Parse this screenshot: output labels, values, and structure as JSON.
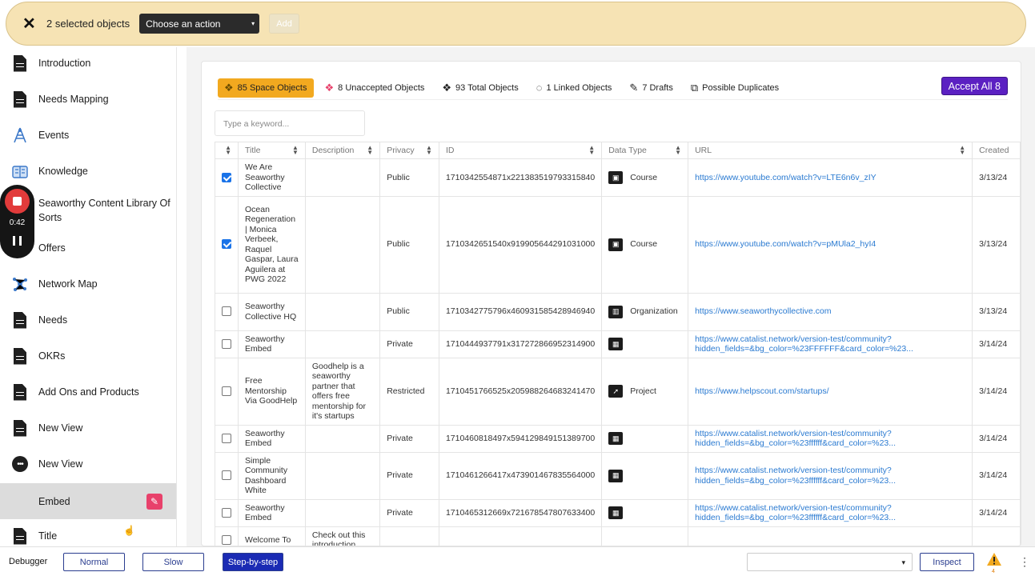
{
  "topbar": {
    "selected_text": "2 selected objects",
    "action_placeholder": "Choose an action",
    "add_label": "Add"
  },
  "sidebar": {
    "items": [
      {
        "label": "Introduction",
        "icon": "document-icon"
      },
      {
        "label": "Needs Mapping",
        "icon": "document-icon"
      },
      {
        "label": "Events",
        "icon": "events-icon"
      },
      {
        "label": "Knowledge",
        "icon": "knowledge-icon"
      },
      {
        "label": "Seaworthy Content Library Of Sorts",
        "icon": "library-icon"
      },
      {
        "label": "Offers",
        "icon": "offers-icon"
      },
      {
        "label": "Network Map",
        "icon": "network-icon"
      },
      {
        "label": "Needs",
        "icon": "document-icon"
      },
      {
        "label": "OKRs",
        "icon": "document-icon"
      },
      {
        "label": "Add Ons and Products",
        "icon": "document-icon"
      },
      {
        "label": "New View",
        "icon": "document-icon"
      },
      {
        "label": "New View",
        "icon": "chat-icon"
      },
      {
        "label": "Embed",
        "icon": "none"
      },
      {
        "label": "Title",
        "icon": "document-icon"
      }
    ]
  },
  "recorder": {
    "time": "0:42"
  },
  "tabs": [
    {
      "label": "85 Space Objects",
      "icon": "cubes-icon"
    },
    {
      "label": "8 Unaccepted Objects",
      "icon": "cubes-icon"
    },
    {
      "label": "93 Total Objects",
      "icon": "cubes-icon"
    },
    {
      "label": "1 Linked Objects",
      "icon": "dotted-circle-icon"
    },
    {
      "label": "7 Drafts",
      "icon": "pencil-icon"
    },
    {
      "label": "Possible Duplicates",
      "icon": "duplicate-icon"
    }
  ],
  "accept_label": "Accept All 8",
  "search_placeholder": "Type a keyword...",
  "table": {
    "columns": [
      "Title",
      "Description",
      "Privacy",
      "ID",
      "Data Type",
      "URL",
      "Created"
    ],
    "rows": [
      {
        "checked": true,
        "title": "We Are Seaworthy Collective",
        "description": "",
        "privacy": "Public",
        "id": "1710342554871x221383519793315840",
        "type": "Course",
        "type_icon": "course-icon",
        "url": "https://www.youtube.com/watch?v=LTE6n6v_zIY",
        "created": "3/13/24"
      },
      {
        "checked": true,
        "title": "Ocean Regeneration | Monica Verbeek, Raquel Gaspar, Laura Aguilera at PWG 2022",
        "description": "",
        "privacy": "Public",
        "id": "1710342651540x919905644291031000",
        "type": "Course",
        "type_icon": "course-icon",
        "url": "https://www.youtube.com/watch?v=pMUla2_hyI4",
        "created": "3/13/24"
      },
      {
        "checked": false,
        "title": "Seaworthy Collective HQ",
        "description": "",
        "privacy": "Public",
        "id": "1710342775796x460931585428946940",
        "type": "Organization",
        "type_icon": "building-icon",
        "url": "https://www.seaworthycollective.com",
        "created": "3/13/24"
      },
      {
        "checked": false,
        "title": "Seaworthy Embed",
        "description": "",
        "privacy": "Private",
        "id": "1710444937791x317272866952314900",
        "type": "",
        "type_icon": "embed-icon",
        "url": "https://www.catalist.network/version-test/community?hidden_fields=&bg_color=%23FFFFFF&card_color=%23...",
        "created": "3/14/24"
      },
      {
        "checked": false,
        "title": "Free Mentorship Via GoodHelp",
        "description": "Goodhelp is a seaworthy partner that offers free mentorship for it's startups",
        "privacy": "Restricted",
        "id": "1710451766525x205988264683241470",
        "type": "Project",
        "type_icon": "rocket-icon",
        "url": "https://www.helpscout.com/startups/",
        "created": "3/14/24"
      },
      {
        "checked": false,
        "title": "Seaworthy Embed",
        "description": "",
        "privacy": "Private",
        "id": "1710460818497x594129849151389700",
        "type": "",
        "type_icon": "embed-icon",
        "url": "https://www.catalist.network/version-test/community?hidden_fields=&bg_color=%23ffffff&card_color=%23...",
        "created": "3/14/24"
      },
      {
        "checked": false,
        "title": "Simple Community Dashboard White",
        "description": "",
        "privacy": "Private",
        "id": "1710461266417x473901467835564000",
        "type": "",
        "type_icon": "embed-icon",
        "url": "https://www.catalist.network/version-test/community?hidden_fields=&bg_color=%23ffffff&card_color=%23...",
        "created": "3/14/24"
      },
      {
        "checked": false,
        "title": "Seaworthy Embed",
        "description": "",
        "privacy": "Private",
        "id": "1710465312669x721678547807633400",
        "type": "",
        "type_icon": "embed-icon",
        "url": "https://www.catalist.network/version-test/community?hidden_fields=&bg_color=%23ffffff&card_color=%23...",
        "created": "3/14/24"
      },
      {
        "checked": false,
        "title": "Welcome To",
        "description": "Check out this introduction",
        "privacy": "",
        "id": "",
        "type": "",
        "type_icon": "",
        "url": "",
        "created": ""
      }
    ]
  },
  "footer": {
    "debugger_label": "Debugger",
    "normal": "Normal",
    "slow": "Slow",
    "step": "Step-by-step",
    "inspect": "Inspect",
    "warn_count": "4"
  }
}
